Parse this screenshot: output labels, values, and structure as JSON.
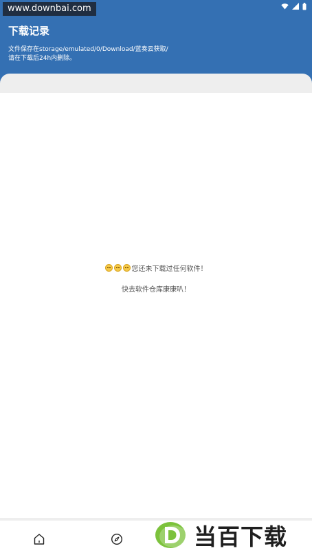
{
  "watermark_top": "www.downbai.com",
  "header": {
    "title": "下载记录",
    "desc_line1": "文件保存在storage/emulated/0/Download/蓝奏云获取/",
    "desc_line2": "请在下载后24h内删除。"
  },
  "empty_state": {
    "line1": "您还未下载过任何软件！",
    "line2": "快去软件仓库康康叭！"
  },
  "nav": {
    "items": [
      {
        "icon": "home-icon"
      },
      {
        "icon": "compass-icon"
      }
    ]
  },
  "brand": {
    "text": "当百下载",
    "logo_letter": "D"
  },
  "colors": {
    "header_bg": "#3470B3",
    "card_bg": "#EEEEEE",
    "logo_green": "#7CC23C"
  }
}
